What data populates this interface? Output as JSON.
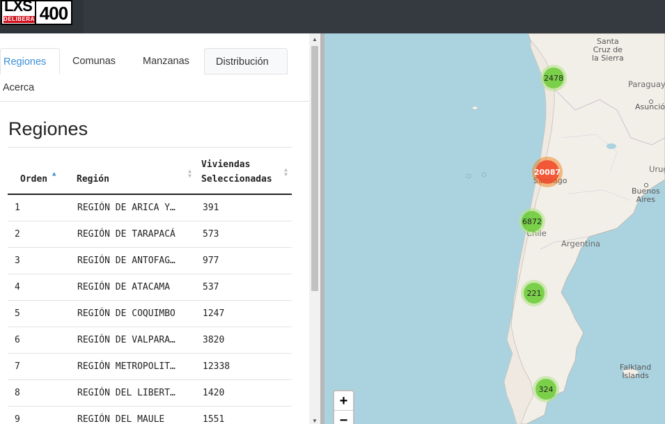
{
  "app": {
    "logo_text_main": "LXS",
    "logo_text_sub": "DELIBERA",
    "logo_text_number": "400"
  },
  "tabs": [
    {
      "label": "Regiones",
      "active": true
    },
    {
      "label": "Comunas",
      "active": false
    },
    {
      "label": "Manzanas",
      "active": false
    },
    {
      "label": "Distribución",
      "active": false
    },
    {
      "label": "Acerca",
      "active": false
    }
  ],
  "page": {
    "title": "Regiones"
  },
  "table": {
    "headers": [
      "Orden",
      "Región",
      "Viviendas Seleccionadas"
    ],
    "header_line1_viviendas": "Viviendas",
    "header_line2_viviendas": "Seleccionadas",
    "sorted_column": "Orden",
    "sort_direction": "ascending",
    "rows": [
      {
        "orden": "1",
        "region": "REGIÓN DE ARICA Y…",
        "viviendas": "391"
      },
      {
        "orden": "2",
        "region": "REGIÓN DE TARAPACÁ",
        "viviendas": "573"
      },
      {
        "orden": "3",
        "region": "REGIÓN DE ANTOFAG…",
        "viviendas": "977"
      },
      {
        "orden": "4",
        "region": "REGIÓN DE ATACAMA",
        "viviendas": "537"
      },
      {
        "orden": "5",
        "region": "REGIÓN DE COQUIMBO",
        "viviendas": "1247"
      },
      {
        "orden": "6",
        "region": "REGIÓN DE VALPARA…",
        "viviendas": "3820"
      },
      {
        "orden": "7",
        "region": "REGIÓN METROPOLIT…",
        "viviendas": "12338"
      },
      {
        "orden": "8",
        "region": "REGIÓN DEL LIBERT…",
        "viviendas": "1420"
      },
      {
        "orden": "9",
        "region": "REGIÓN DEL MAULE",
        "viviendas": "1551"
      }
    ]
  },
  "map": {
    "labels": {
      "santa_cruz": "Santa Cruz de la Sierra",
      "santa_cruz_l1": "Santa",
      "santa_cruz_l2": "Cruz de",
      "santa_cruz_l3": "la Sierra",
      "paraguay": "Paraguay",
      "asuncion": "Asunció",
      "santiago": "Santiago",
      "buenos_aires_l1": "Buenos",
      "buenos_aires_l2": "Aires",
      "uruguay": "Urug",
      "chile": "Chile",
      "argentina": "Argentina",
      "falkland_l1": "Falkland",
      "falkland_l2": "Islands"
    },
    "clusters": [
      {
        "count": "2478",
        "color": "green"
      },
      {
        "count": "20087",
        "color": "red"
      },
      {
        "count": "6872",
        "color": "green"
      },
      {
        "count": "221",
        "color": "green"
      },
      {
        "count": "324",
        "color": "green"
      }
    ],
    "zoom_in": "+",
    "zoom_out": "−",
    "colors": {
      "ocean": "#aad3df",
      "land": "#f2efe9",
      "cluster_green": "#6ecc39",
      "cluster_red": "#f14826",
      "tab_active": "#3a8fd8"
    }
  }
}
